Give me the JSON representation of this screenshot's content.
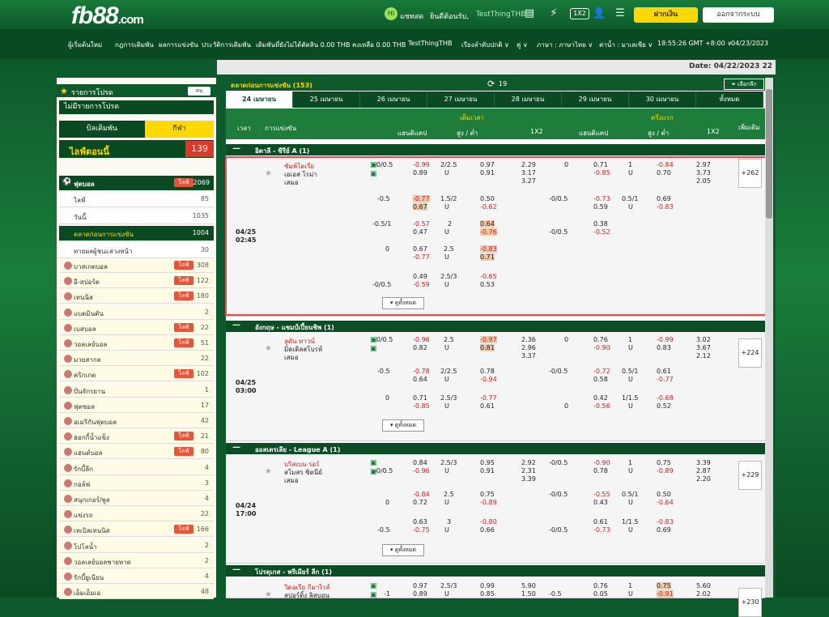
{
  "header": {
    "logo": "fb88",
    "logo_suffix": ".com",
    "user_label": "แชทสด",
    "welcome": "ยินดีต้อนรับ,",
    "username": "TestThingTHB",
    "deposit": "ฝากเงิน",
    "logout": "ออกจากระบบ"
  },
  "nav": {
    "items": [
      "ผู้เริ่มต้นใหม่",
      "กฎการเดิมพัน",
      "ผลการแข่งขัน",
      "ประวัติการเดิมพัน",
      "เดิมพันที่ยังไม่ได้ตัดสิน 0.00 THB",
      "คงเหลือ 0.00 THB",
      "TestThingTHB",
      "เรียงลำดับปกติ ∨",
      "คู่ ∨",
      "ภาษา : ภาษาไทย ∨",
      "ค่าน้ำ : มาเลเซีย ∨",
      "18:55:26 GMT +8:00 ∨",
      "04/23/2023"
    ],
    "date": "Date: 04/22/2023 22"
  },
  "left": {
    "fav_title": "รายการโปรด",
    "del": "ลบ",
    "no_fav": "ไม่มีรายการโปรด",
    "tab_bets": "บิลเดิมพัน",
    "tab_sports": "กีฬา",
    "live_now": "ไลฟ์ตอนนี้",
    "live_count": "139",
    "sports_title": "กีฬา",
    "football": {
      "label": "ฟุตบอล",
      "live": "ไลฟ์",
      "count": "2069"
    },
    "sub": [
      {
        "label": "ไลฟ์",
        "count": "85"
      },
      {
        "label": "วันนี้",
        "count": "1035"
      },
      {
        "label": "ตลาดก่อนการแข่งขัน",
        "count": "1004"
      },
      {
        "label": "ทายผลผู้ชนะล่วงหน้า",
        "count": "30"
      }
    ],
    "sports": [
      {
        "label": "บาสเกตบอล",
        "live": "ไลฟ์",
        "count": "308"
      },
      {
        "label": "อี-สปอร์ต",
        "live": "ไลฟ์",
        "count": "122"
      },
      {
        "label": "เทนนิส",
        "live": "ไลฟ์",
        "count": "180"
      },
      {
        "label": "แบดมินตัน",
        "live": "",
        "count": "2"
      },
      {
        "label": "เบสบอล",
        "live": "ไลฟ์",
        "count": "22"
      },
      {
        "label": "วอลเลย์บอล",
        "live": "ไลฟ์",
        "count": "51"
      },
      {
        "label": "มวยสากล",
        "live": "",
        "count": "22"
      },
      {
        "label": "คริกเกต",
        "live": "ไลฟ์",
        "count": "102"
      },
      {
        "label": "ปั่นจักรยาน",
        "live": "",
        "count": "1"
      },
      {
        "label": "ฟุตซอล",
        "live": "",
        "count": "17"
      },
      {
        "label": "อเมริกันฟุตบอล",
        "live": "",
        "count": "42"
      },
      {
        "label": "ฮอกกี้น้ำแข็ง",
        "live": "ไลฟ์",
        "count": "21"
      },
      {
        "label": "แฮนด์บอล",
        "live": "ไลฟ์",
        "count": "80"
      },
      {
        "label": "รักบี้ลีก",
        "live": "",
        "count": "4"
      },
      {
        "label": "กอล์ฟ",
        "live": "",
        "count": "3"
      },
      {
        "label": "สนุกเกอร์/พูล",
        "live": "",
        "count": "4"
      },
      {
        "label": "แข่งรถ",
        "live": "",
        "count": "22"
      },
      {
        "label": "เทเบิลเทนนิส",
        "live": "ไลฟ์",
        "count": "166"
      },
      {
        "label": "โปโลน้ำ",
        "live": "",
        "count": "2"
      },
      {
        "label": "วอลเลย์บอลชายหาด",
        "live": "",
        "count": "2"
      },
      {
        "label": "รักบี้ยูเนียน",
        "live": "",
        "count": "4"
      },
      {
        "label": "เอ็มเอ็มเอ",
        "live": "",
        "count": "48"
      }
    ]
  },
  "main": {
    "title": "ตลาดก่อนการแข่งขัน (153)",
    "refresh": "19",
    "select": "เลือกลีก",
    "tabs": [
      "24 เมษายน",
      "25 เมษายน",
      "26 เมษายน",
      "27 เมษายน",
      "28 เมษายน",
      "29 เมษายน",
      "30 เมษายน",
      "ทั้งหมด"
    ],
    "col": {
      "time": "เวลา",
      "match": "การแข่งขัน",
      "full": "เต็มเวลา",
      "half": "ครึ่งแรก",
      "hdp": "แฮนดิแคป",
      "ou": "สูง / ต่ำ",
      "x12": "1X2",
      "hdp2": "แฮนดิแคป",
      "ou2": "สูง / ต่ำ",
      "x122": "1X2",
      "more": "เพิ่มเติม"
    },
    "more_btn": "ดูทั้งหมด",
    "leagues": [
      {
        "name": "อิตาลี - ซีรีย์ A (1)",
        "date": "04/25",
        "time": "02:45",
        "home": "ซัมพ์โดเรีย",
        "away": "เอเอส โรม่า",
        "draw": "เสมอ",
        "plus": "+262"
      },
      {
        "name": "อังกฤษ - แชมป์เปี้ยนชิพ (1)",
        "date": "04/25",
        "time": "03:00",
        "home": "ลูตัน ทาวน์",
        "away": "มิดเดิลสโบรห์",
        "draw": "เสมอ",
        "plus": "+224"
      },
      {
        "name": "ออสเตรเลีย - League A (1)",
        "date": "04/24",
        "time": "17:00",
        "home": "บริสเบน รอร์",
        "away": "สโมสร ซิดนีย์",
        "draw": "เสมอ",
        "plus": "+229"
      },
      {
        "name": "โปรตุเกส - พรีเมียร์ ลีก (1)",
        "home": "วิตอเรีย กีมาไรส์",
        "away": "สปอร์ติ้ง ลิสบอน",
        "plus": "+230"
      }
    ]
  }
}
